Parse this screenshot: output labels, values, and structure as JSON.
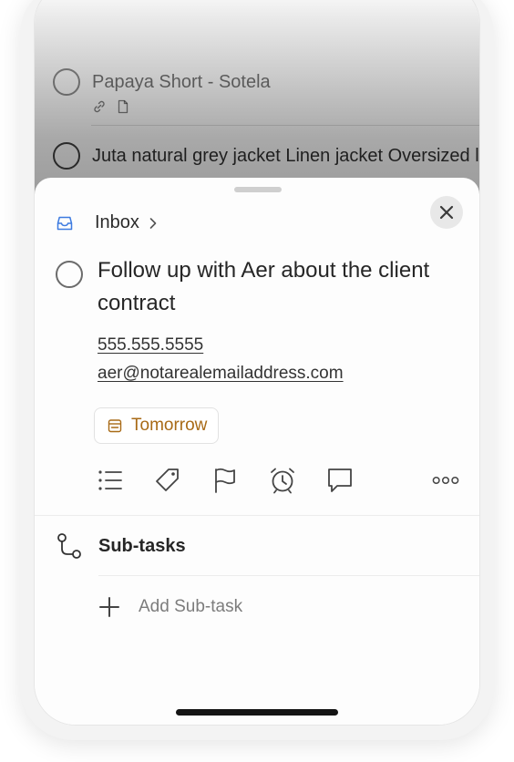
{
  "background_list": {
    "items": [
      {
        "title": "Papaya Short - Sotela",
        "meta_icons": [
          "link-icon",
          "note-icon"
        ]
      },
      {
        "title": "Juta natural grey jacket Linen jacket Oversized linen | Etsy"
      }
    ]
  },
  "sheet": {
    "breadcrumb": {
      "label": "Inbox",
      "icon": "inbox-icon"
    },
    "close_icon": "close-icon",
    "task": {
      "title": "Follow up with Aer about the client contract",
      "phone": "555.555.5555",
      "email": "aer@notarealemailaddress.com"
    },
    "due_date": {
      "label": "Tomorrow",
      "icon": "calendar-icon",
      "color": "#a86a16"
    },
    "toolbar": [
      "list-icon",
      "tag-icon",
      "flag-icon",
      "alarm-icon",
      "comment-icon",
      "more-icon"
    ],
    "subtasks": {
      "label": "Sub-tasks",
      "icon": "subtasks-icon",
      "add_label": "Add Sub-task"
    }
  }
}
